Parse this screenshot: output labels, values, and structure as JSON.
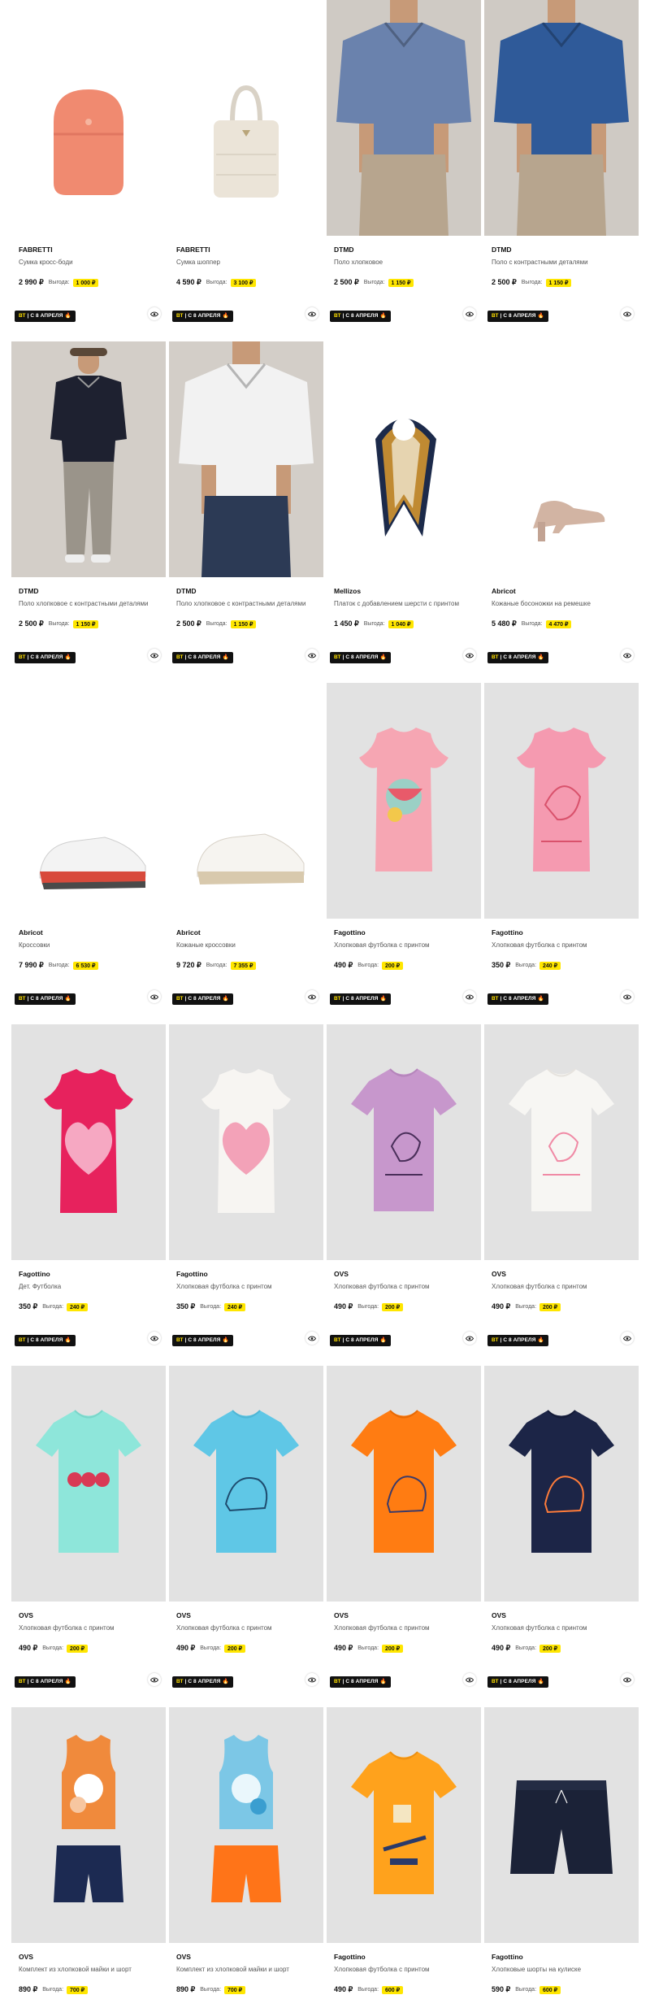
{
  "promo": {
    "bt": "ВТ",
    "label": "С 8 АПРЕЛЯ",
    "icon": "flame-icon"
  },
  "currency": "₽",
  "saving_label": "Выгода:",
  "products": [
    {
      "brand": "FABRETTI",
      "desc": "Сумка кросс-боди",
      "price": "2 990 ₽",
      "saving": "1 000 ₽",
      "image": "crossbody-bag-coral",
      "bg": "#ffffff"
    },
    {
      "brand": "FABRETTI",
      "desc": "Сумка шоппер",
      "price": "4 590 ₽",
      "saving": "3 100 ₽",
      "image": "tote-bag-beige",
      "bg": "#ffffff"
    },
    {
      "brand": "DTMD",
      "desc": "Поло хлопковое",
      "price": "2 500 ₽",
      "saving": "1 150 ₽",
      "image": "polo-blue-man",
      "bg": "#cfcac4"
    },
    {
      "brand": "DTMD",
      "desc": "Поло с контрастными деталями",
      "price": "2 500 ₽",
      "saving": "1 150 ₽",
      "image": "polo-navy-man",
      "bg": "#cfcac4"
    },
    {
      "brand": "DTMD",
      "desc": "Поло хлопковое с контрастными деталями",
      "price": "2 500 ₽",
      "saving": "1 150 ₽",
      "image": "polo-black-man-fullbody",
      "bg": "#d3cec8"
    },
    {
      "brand": "DTMD",
      "desc": "Поло хлопковое с контрастными деталями",
      "price": "2 500 ₽",
      "saving": "1 150 ₽",
      "image": "polo-white-man",
      "bg": "#d3cec8"
    },
    {
      "brand": "Mellizos",
      "desc": "Платок с добавлением шерсти с принтом",
      "price": "1 450 ₽",
      "saving": "1 040 ₽",
      "image": "scarf-gold-navy",
      "bg": "#ffffff"
    },
    {
      "brand": "Abricot",
      "desc": "Кожаные босоножки на ремешке",
      "price": "5 480 ₽",
      "saving": "4 470 ₽",
      "image": "sandal-nude",
      "bg": "#ffffff"
    },
    {
      "brand": "Abricot",
      "desc": "Кроссовки",
      "price": "7 990 ₽",
      "saving": "6 530 ₽",
      "image": "sneaker-white-red",
      "bg": "#ffffff"
    },
    {
      "brand": "Abricot",
      "desc": "Кожаные кроссовки",
      "price": "9 720 ₽",
      "saving": "7 355 ₽",
      "image": "sneaker-white-beige",
      "bg": "#ffffff"
    },
    {
      "brand": "Fagottino",
      "desc": "Хлопковая футболка с принтом",
      "price": "490 ₽",
      "saving": "200 ₽",
      "image": "tshirt-pink-watermelon",
      "bg": "#e2e2e2"
    },
    {
      "brand": "Fagottino",
      "desc": "Хлопковая футболка с принтом",
      "price": "350 ₽",
      "saving": "240 ₽",
      "image": "tshirt-pink-unicorn",
      "bg": "#e2e2e2"
    },
    {
      "brand": "Fagottino",
      "desc": "Дет. Футболка",
      "price": "350 ₽",
      "saving": "240 ₽",
      "image": "tshirt-crimson-heart",
      "bg": "#e2e2e2"
    },
    {
      "brand": "Fagottino",
      "desc": "Хлопковая футболка с принтом",
      "price": "350 ₽",
      "saving": "240 ₽",
      "image": "tshirt-white-heart",
      "bg": "#e2e2e2"
    },
    {
      "brand": "OVS",
      "desc": "Хлопковая футболка с принтом",
      "price": "490 ₽",
      "saving": "200 ₽",
      "image": "tshirt-lilac-unicorn",
      "bg": "#e2e2e2"
    },
    {
      "brand": "OVS",
      "desc": "Хлопковая футболка с принтом",
      "price": "490 ₽",
      "saving": "200 ₽",
      "image": "tshirt-white-unicorn",
      "bg": "#e2e2e2"
    },
    {
      "brand": "OVS",
      "desc": "Хлопковая футболка с принтом",
      "price": "490 ₽",
      "saving": "200 ₽",
      "image": "tshirt-mint-hearts",
      "bg": "#e2e2e2"
    },
    {
      "brand": "OVS",
      "desc": "Хлопковая футболка с принтом",
      "price": "490 ₽",
      "saving": "200 ₽",
      "image": "tshirt-skyblue-dino",
      "bg": "#e2e2e2"
    },
    {
      "brand": "OVS",
      "desc": "Хлопковая футболка с принтом",
      "price": "490 ₽",
      "saving": "200 ₽",
      "image": "tshirt-orange-dino",
      "bg": "#e2e2e2"
    },
    {
      "brand": "OVS",
      "desc": "Хлопковая футболка с принтом",
      "price": "490 ₽",
      "saving": "200 ₽",
      "image": "tshirt-navy-dino",
      "bg": "#e2e2e2"
    },
    {
      "brand": "OVS",
      "desc": "Комплект из хлопковой майки и шорт",
      "price": "890 ₽",
      "saving": "700 ₽",
      "image": "set-orange-tank-navy-shorts",
      "bg": "#e2e2e2"
    },
    {
      "brand": "OVS",
      "desc": "Комплект из хлопковой майки и шорт",
      "price": "890 ₽",
      "saving": "700 ₽",
      "image": "set-blue-tank-orange-shorts",
      "bg": "#e2e2e2"
    },
    {
      "brand": "Fagottino",
      "desc": "Хлопковая футболка с принтом",
      "price": "490 ₽",
      "saving": "600 ₽",
      "image": "tshirt-orange-surf",
      "bg": "#e2e2e2"
    },
    {
      "brand": "Fagottino",
      "desc": "Хлопковые шорты на кулиске",
      "price": "590 ₽",
      "saving": "600 ₽",
      "image": "shorts-navy",
      "bg": "#e2e2e2"
    }
  ]
}
